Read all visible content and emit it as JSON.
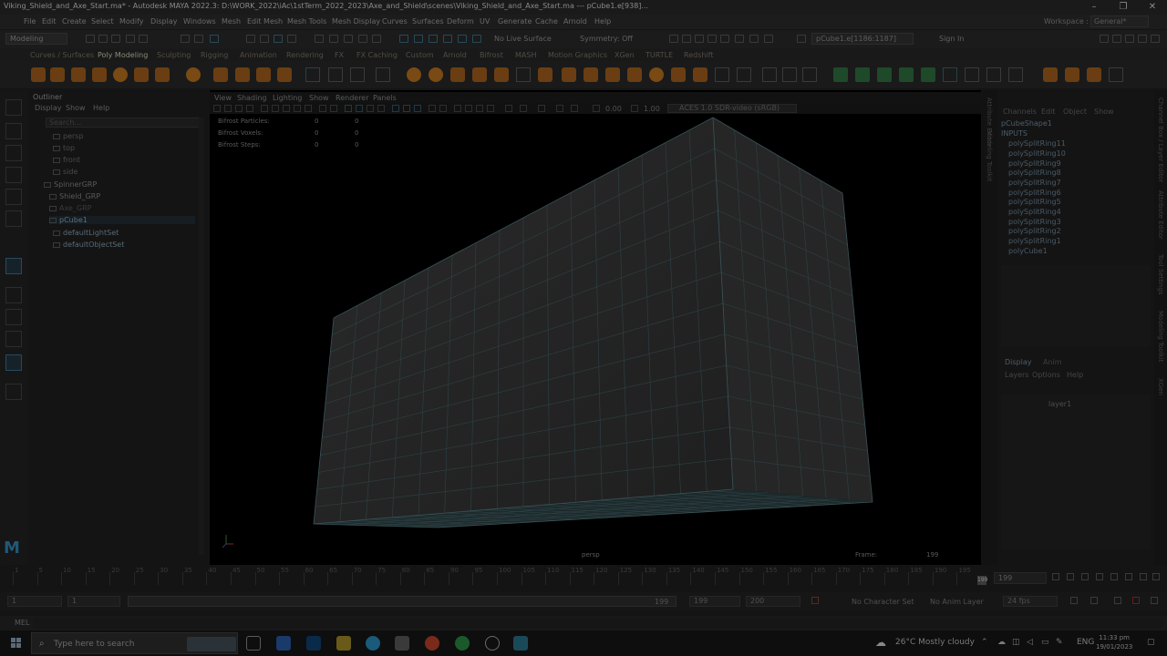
{
  "window": {
    "title": "Viking_Shield_and_Axe_Start.ma* - Autodesk MAYA 2022.3: D:\\WORK_2022\\iAc\\1stTerm_2022_2023\\Axe_and_Shield\\scenes\\Viking_Shield_and_Axe_Start.ma   ---   pCube1.e[938]...",
    "controls": [
      "–",
      "❐",
      "✕"
    ]
  },
  "menubar": {
    "items": [
      "File",
      "Edit",
      "Create",
      "Select",
      "Modify",
      "Display",
      "Windows",
      "Mesh",
      "Edit Mesh",
      "Mesh Tools",
      "Mesh Display",
      "Curves",
      "Surfaces",
      "Deform",
      "UV",
      "Generate",
      "Cache",
      "Arnold",
      "Help"
    ],
    "workspace_label": "Workspace :",
    "workspace_value": "General*"
  },
  "statusline": {
    "mode": "Modeling",
    "live_surface": "No Live Surface",
    "symmetry": "Symmetry: Off",
    "object_field": "pCube1.e[1186:1187]",
    "sign_in": "Sign In"
  },
  "shelf_tabs": [
    "Curves / Surfaces",
    "Poly Modeling",
    "Sculpting",
    "Rigging",
    "Animation",
    "Rendering",
    "FX",
    "FX Caching",
    "Custom",
    "Arnold",
    "Bifrost",
    "MASH",
    "Motion Graphics",
    "XGen",
    "TURTLE",
    "Redshift"
  ],
  "shelf_active_tab": "Poly Modeling",
  "outliner": {
    "title": "Outliner",
    "menu": [
      "Display",
      "Show",
      "Help"
    ],
    "search_placeholder": "Search...",
    "items": [
      {
        "label": "persp"
      },
      {
        "label": "top"
      },
      {
        "label": "front"
      },
      {
        "label": "side"
      },
      {
        "label": "SpinnerGRP"
      },
      {
        "label": "Shield_GRP"
      },
      {
        "label": "Axe_GRP"
      },
      {
        "label": "pCube1"
      },
      {
        "label": "defaultLightSet"
      },
      {
        "label": "defaultObjectSet"
      }
    ]
  },
  "viewport": {
    "menu": [
      "View",
      "Shading",
      "Lighting",
      "Show",
      "Renderer",
      "Panels"
    ],
    "exposure": "0.00",
    "gamma": "1.00",
    "color_space": "ACES 1.0 SDR-video (sRGB)",
    "hud": [
      {
        "label": "Bifrost Particles:",
        "v1": "0",
        "v2": "0"
      },
      {
        "label": "Bifrost Voxels:",
        "v1": "0",
        "v2": "0"
      },
      {
        "label": "Bifrost Steps:",
        "v1": "0",
        "v2": "0"
      }
    ],
    "camera": "persp",
    "frame_label": "Frame:",
    "frame_value": "199"
  },
  "channelbox": {
    "menu": [
      "Channels",
      "Edit",
      "Object",
      "Show"
    ],
    "shape": "pCubeShape1",
    "inputs_label": "INPUTS",
    "inputs": [
      "polySplitRing11",
      "polySplitRing10",
      "polySplitRing9",
      "polySplitRing8",
      "polySplitRing7",
      "polySplitRing6",
      "polySplitRing5",
      "polySplitRing4",
      "polySplitRing3",
      "polySplitRing2",
      "polySplitRing1",
      "polyCube1"
    ],
    "layer_tabs": [
      "Display",
      "Anim"
    ],
    "layer_menu": [
      "Layers",
      "Options",
      "Help"
    ],
    "layer_name": "layer1"
  },
  "side_labels_left": [
    "Attribute Editor",
    "Modeling Toolkit"
  ],
  "side_labels_right": [
    "Channel Box / Layer Editor",
    "Attribute Editor",
    "Tool Settings",
    "Modeling Toolkit",
    "XGen"
  ],
  "timeline": {
    "ticks": [
      "1",
      "5",
      "10",
      "15",
      "20",
      "25",
      "30",
      "35",
      "40",
      "45",
      "50",
      "55",
      "60",
      "65",
      "70",
      "75",
      "80",
      "85",
      "90",
      "95",
      "100",
      "105",
      "110",
      "115",
      "120",
      "125",
      "130",
      "135",
      "140",
      "145",
      "150",
      "155",
      "160",
      "165",
      "170",
      "175",
      "180",
      "185",
      "190",
      "195"
    ],
    "current_frame": "199",
    "current_marker": "199"
  },
  "range": {
    "start": "1",
    "start_inner": "1",
    "end_inner": "199",
    "end": "199",
    "max": "200",
    "character_set": "No Character Set",
    "anim_layer": "No Anim Layer",
    "fps": "24 fps"
  },
  "command_line": {
    "label": "MEL"
  },
  "taskbar": {
    "search_placeholder": "Type here to search",
    "weather": "26°C  Mostly cloudy",
    "language": "ENG",
    "time": "11:33 pm",
    "date": "19/01/2023"
  }
}
